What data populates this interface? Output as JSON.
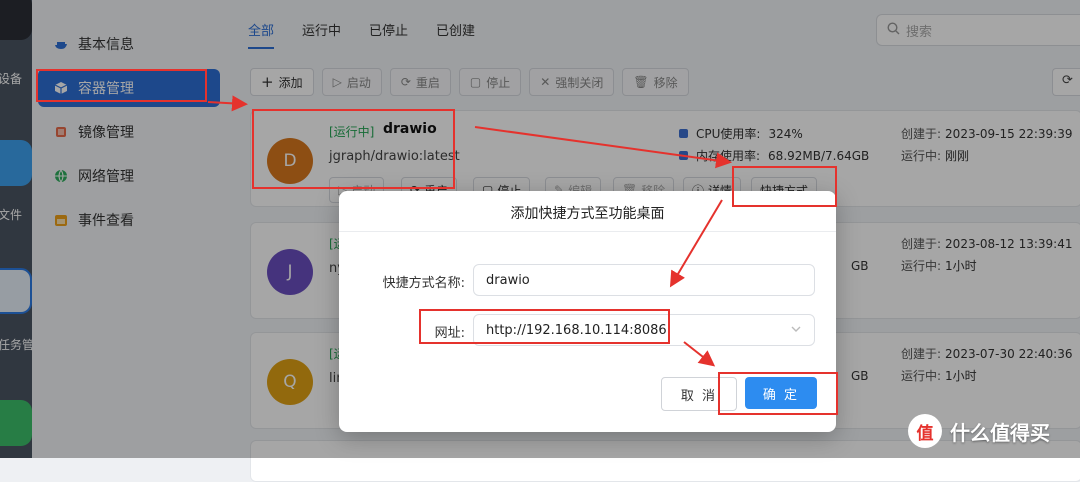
{
  "dock": {
    "labels": [
      "设备",
      "文件",
      "任务管"
    ]
  },
  "sidebar": {
    "items": [
      {
        "label": "基本信息",
        "icon": "docker-icon"
      },
      {
        "label": "容器管理",
        "icon": "cube-icon"
      },
      {
        "label": "镜像管理",
        "icon": "image-layer-icon"
      },
      {
        "label": "网络管理",
        "icon": "globe-icon"
      },
      {
        "label": "事件查看",
        "icon": "calendar-icon"
      }
    ]
  },
  "tabs": [
    "全部",
    "运行中",
    "已停止",
    "已创建"
  ],
  "search": {
    "placeholder": "搜索"
  },
  "toolbar": {
    "add": "添加",
    "start": "启动",
    "restart": "重启",
    "stop": "停止",
    "force_close": "强制关闭",
    "remove": "移除"
  },
  "cards": [
    {
      "initial": "D",
      "color": "#d9781e",
      "status": "[运行中]",
      "name": "drawio",
      "image": "jgraph/drawio:latest",
      "cpu_label": "CPU使用率:",
      "cpu": "324%",
      "mem_label": "内存使用率:",
      "mem": "68.92MB/7.64GB",
      "created_label": "创建于:",
      "created": "2023-09-15 22:39:39",
      "running_label": "运行中:",
      "running": "刚刚"
    },
    {
      "initial": "J",
      "color": "#6a4fc1",
      "status": "[运",
      "name": "",
      "image": "ny",
      "mem": "GB",
      "created_label": "创建于:",
      "created": "2023-08-12 13:39:41",
      "running_label": "运行中:",
      "running": "1小时"
    },
    {
      "initial": "Q",
      "color": "#e0a214",
      "status": "[运",
      "name": "",
      "image": "lin",
      "mem": "GB",
      "created_label": "创建于:",
      "created": "2023-07-30 22:40:36",
      "running_label": "运行中:",
      "running": "1小时"
    }
  ],
  "card_actions": {
    "start": "启动",
    "restart": "重启",
    "stop": "停止",
    "edit": "编辑",
    "remove": "移除",
    "detail": "详情",
    "shortcut": "快捷方式"
  },
  "dialog": {
    "title": "添加快捷方式至功能桌面",
    "name_label": "快捷方式名称:",
    "name_value": "drawio",
    "url_label": "网址:",
    "url_value": "http://192.168.10.114:8086",
    "cancel": "取 消",
    "ok": "确 定"
  },
  "watermark": {
    "logo": "值",
    "text": "什么值得买"
  },
  "colors": {
    "accent": "#2d6fd6",
    "primary_button": "#2d8cf0",
    "annotation_red": "#e5322d",
    "running_green": "#23a554"
  }
}
